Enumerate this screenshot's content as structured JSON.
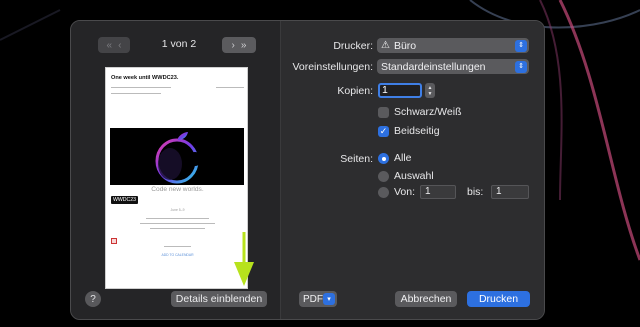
{
  "nav": {
    "prev_icon": "chevron-left-icon",
    "prev_double_icon": "double-chevron-left-icon",
    "next_icon": "chevron-right-icon",
    "next_double_icon": "double-chevron-right-icon",
    "page_counter": "1 von 2"
  },
  "preview": {
    "subject": "One week until WWDC23.",
    "tagline": "Code new worlds.",
    "badge": "WWDC23",
    "date_line": "June 5–9",
    "link_text": "ADD TO CALENDAR"
  },
  "left_footer": {
    "help_label": "?",
    "details_label": "Details einblenden"
  },
  "form": {
    "printer_label": "Drucker:",
    "printer_value": "Büro",
    "printer_icon": "warning-icon",
    "presets_label": "Voreinstellungen:",
    "presets_value": "Standardeinstellungen",
    "copies_label": "Kopien:",
    "copies_value": "1",
    "bw_label": "Schwarz/Weiß",
    "bw_checked": false,
    "duplex_label": "Beidseitig",
    "duplex_checked": true,
    "pages_label": "Seiten:",
    "all_label": "Alle",
    "selection_label": "Auswahl",
    "from_label": "Von:",
    "from_value": "1",
    "to_label": "bis:",
    "to_value": "1"
  },
  "footer": {
    "pdf_label": "PDF",
    "cancel_label": "Abbrechen",
    "print_label": "Drucken"
  },
  "colors": {
    "accent": "#2d70e0",
    "annotation_arrow": "#b7e21d",
    "dialog_bg": "#2b2b2d"
  }
}
